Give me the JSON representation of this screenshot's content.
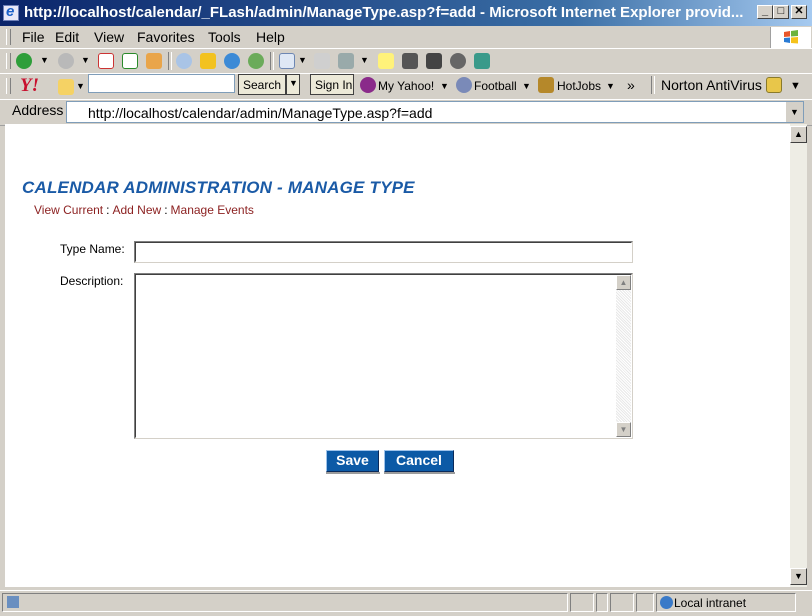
{
  "window": {
    "title": "http://localhost/calendar/_FLash/admin/ManageType.asp?f=add - Microsoft Internet Explorer provid...",
    "min": "_",
    "max": "□",
    "close": "✕"
  },
  "menu": {
    "file": "File",
    "edit": "Edit",
    "view": "View",
    "favorites": "Favorites",
    "tools": "Tools",
    "help": "Help"
  },
  "yahoo_toolbar": {
    "logo": "Y!",
    "search_value": "",
    "search_button": "Search",
    "sign_in": "Sign In",
    "my_yahoo": "My Yahoo!",
    "football": "Football",
    "hotjobs": "HotJobs",
    "more": "»",
    "norton": "Norton AntiVirus"
  },
  "address_bar": {
    "label": "Address",
    "url": "http://localhost/calendar/admin/ManageType.asp?f=add"
  },
  "page": {
    "heading": "CALENDAR ADMINISTRATION - MANAGE TYPE",
    "nav": {
      "view_current": "View Current",
      "divider": ":",
      "add_new": "Add New",
      "manage_events": "Manage Events"
    },
    "form": {
      "type_name_label": "Type Name:",
      "type_name_value": "",
      "description_label": "Description:",
      "description_value": "",
      "save": "Save",
      "cancel": "Cancel"
    }
  },
  "status_bar": {
    "zone": "Local intranet"
  },
  "colors": {
    "heading": "#1a5aa6",
    "nav_link": "#8b1f1f",
    "button": "#0c5aa6"
  }
}
